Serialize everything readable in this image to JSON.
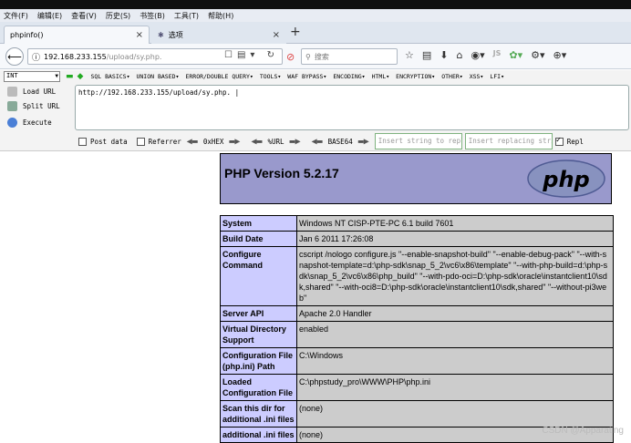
{
  "menubar": {
    "items": [
      "文件(F)",
      "编辑(E)",
      "查看(V)",
      "历史(S)",
      "书签(B)",
      "工具(T)",
      "帮助(H)"
    ]
  },
  "tabs": [
    {
      "title": "phpinfo()",
      "close": "×"
    },
    {
      "title": "选项",
      "close": "×"
    }
  ],
  "navbar": {
    "url_host": "192.168.233.155",
    "url_path": "/upload/sy.php.",
    "search_placeholder": "搜索"
  },
  "hackbar": {
    "select_value": "INT",
    "menu": [
      "SQL BASICS▾",
      "UNION BASED▾",
      "ERROR/DOUBLE QUERY▾",
      "TOOLS▾",
      "WAF BYPASS▾",
      "ENCODING▾",
      "HTML▾",
      "ENCRYPTION▾",
      "OTHER▾",
      "XSS▾",
      "LFI▾"
    ],
    "load_url": "Load URL",
    "split_url": "Split URL",
    "execute": "Execute",
    "textarea": "http://192.168.233.155/upload/sy.php. |",
    "post_data": "Post data",
    "referrer": "Referrer",
    "hex": "0xHEX",
    "url_enc": "%URL",
    "base64": "BASE64",
    "insert_placeholder": "Insert string to replace",
    "replace_placeholder": "Insert replacing string",
    "replace_all": "Repl"
  },
  "php": {
    "title": "PHP Version 5.2.17",
    "logo_text": "php",
    "rows": [
      {
        "k": "System",
        "v": "Windows NT CISP-PTE-PC 6.1 build 7601"
      },
      {
        "k": "Build Date",
        "v": "Jan 6 2011 17:26:08"
      },
      {
        "k": "Configure Command",
        "v": "cscript /nologo configure.js \"--enable-snapshot-build\" \"--enable-debug-pack\" \"--with-snapshot-template=d:\\php-sdk\\snap_5_2\\vc6\\x86\\template\" \"--with-php-build=d:\\php-sdk\\snap_5_2\\vc6\\x86\\php_build\" \"--with-pdo-oci=D:\\php-sdk\\oracle\\instantclient10\\sdk,shared\" \"--with-oci8=D:\\php-sdk\\oracle\\instantclient10\\sdk,shared\" \"--without-pi3web\""
      },
      {
        "k": "Server API",
        "v": "Apache 2.0 Handler"
      },
      {
        "k": "Virtual Directory Support",
        "v": "enabled"
      },
      {
        "k": "Configuration File (php.ini) Path",
        "v": "C:\\Windows"
      },
      {
        "k": "Loaded Configuration File",
        "v": "C:\\phpstudy_pro\\WWW\\PHP\\php.ini"
      },
      {
        "k": "Scan this dir for additional .ini files",
        "v": "(none)"
      },
      {
        "k": "additional .ini files",
        "v": "(none)"
      }
    ]
  },
  "watermark": "CSDN @Apparating"
}
